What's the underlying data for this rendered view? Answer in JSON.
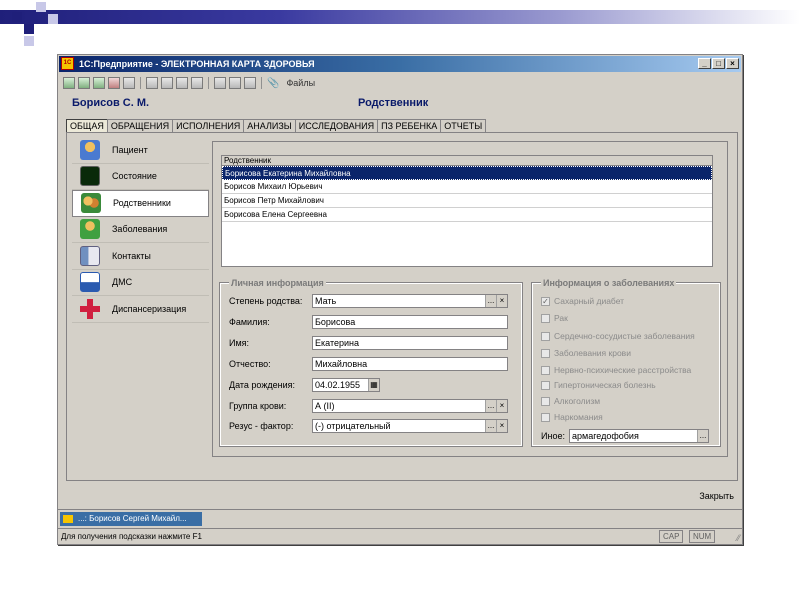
{
  "window": {
    "title": "1С:Предприятие - ЭЛЕКТРОННАЯ КАРТА ЗДОРОВЬЯ",
    "app_icon": "1С",
    "minimize": "_",
    "maximize": "□",
    "close": "×"
  },
  "toolbar": {
    "files_label": "Файлы"
  },
  "header": {
    "patient": "Борисов С. М.",
    "section": "Родственник"
  },
  "tabs": [
    {
      "label": "ОБЩАЯ",
      "active": true
    },
    {
      "label": "ОБРАЩЕНИЯ"
    },
    {
      "label": "ИСПОЛНЕНИЯ"
    },
    {
      "label": "АНАЛИЗЫ"
    },
    {
      "label": "ИССЛЕДОВАНИЯ"
    },
    {
      "label": "ПЗ РЕБЕНКА"
    },
    {
      "label": "ОТЧЕТЫ"
    }
  ],
  "nav": [
    {
      "label": "Пациент",
      "icon": "person-icon",
      "color": "#e8a030"
    },
    {
      "label": "Состояние",
      "icon": "heartbeat-monitor-icon",
      "color": "#1a6a1a"
    },
    {
      "label": "Родственники",
      "icon": "family-icon",
      "color": "#c07020",
      "active": true
    },
    {
      "label": "Заболевания",
      "icon": "doctor-icon",
      "color": "#40a040"
    },
    {
      "label": "Контакты",
      "icon": "contact-card-icon",
      "color": "#4a6aa0"
    },
    {
      "label": "ДМС",
      "icon": "insurance-doc-icon",
      "color": "#2a5ab0"
    },
    {
      "label": "Диспансеризация",
      "icon": "medical-cross-icon",
      "color": "#d02040"
    }
  ],
  "relatives": {
    "header": "Родственник",
    "rows": [
      "Борисова Екатерина Михайловна",
      "Борисов Михаил Юрьевич",
      "Борисов Петр Михайлович",
      "Борисова Елена Сергеевна"
    ],
    "selected_index": 0
  },
  "personal": {
    "title": "Личная информация",
    "fields": [
      {
        "label": "Степень родства:",
        "value": "Мать",
        "buttons": [
          "...",
          "×"
        ]
      },
      {
        "label": "Фамилия:",
        "value": "Борисова"
      },
      {
        "label": "Имя:",
        "value": "Екатерина"
      },
      {
        "label": "Отчество:",
        "value": "Михайловна"
      },
      {
        "label": "Дата рождения:",
        "value": "04.02.1955",
        "calendar": true
      },
      {
        "label": "Группа крови:",
        "value": "А (II)",
        "buttons": [
          "...",
          "×"
        ]
      },
      {
        "label": "Резус - фактор:",
        "value": "(-) отрицательный",
        "buttons": [
          "...",
          "×"
        ]
      }
    ]
  },
  "diseases": {
    "title": "Информация о заболеваниях",
    "items": [
      {
        "label": "Сахарный диабет",
        "checked": true
      },
      {
        "label": "Рак",
        "checked": false
      },
      {
        "label": "Сердечно-сосудистые заболевания",
        "checked": false
      },
      {
        "label": "Заболевания крови",
        "checked": false
      },
      {
        "label": "Нервно-психические расстройства",
        "checked": false
      },
      {
        "label": "Гипертоническая болезнь",
        "checked": false
      },
      {
        "label": "Алкоголизм",
        "checked": false
      },
      {
        "label": "Наркомания",
        "checked": false
      }
    ],
    "other_label": "Иное:",
    "other_value": "армагедофобия",
    "other_button": "..."
  },
  "footer": {
    "close": "Закрыть"
  },
  "taskbar": {
    "item": "...: Борисов Сергей Михайл..."
  },
  "status": {
    "hint": "Для получения подсказки нажмите F1",
    "cap": "CAP",
    "num": "NUM"
  }
}
